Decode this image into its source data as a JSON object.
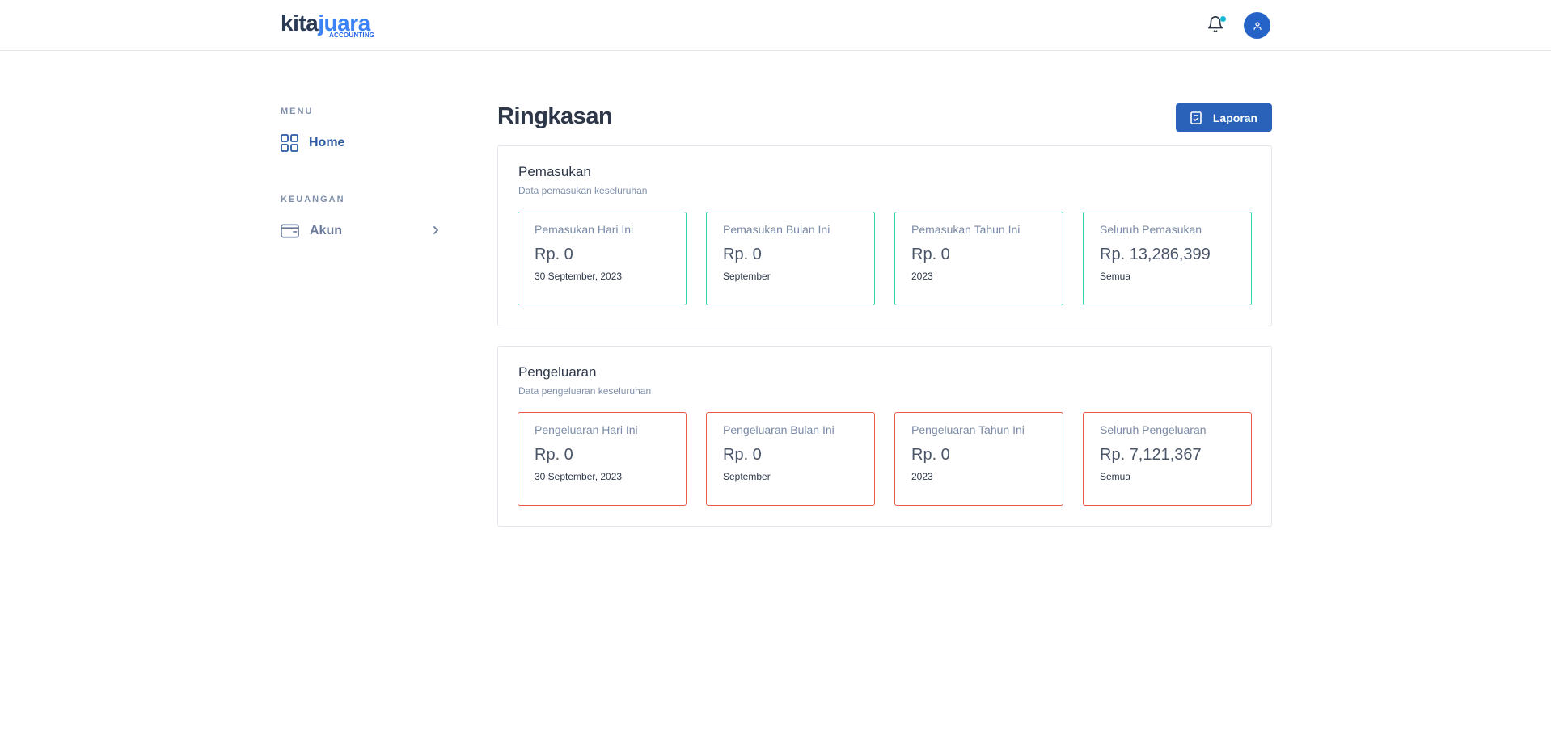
{
  "brand": {
    "part1": "kita",
    "part2": "juara",
    "sub": "ACCOUNTING"
  },
  "header": {
    "bell_icon": "bell-icon",
    "avatar_icon": "user-icon",
    "notification_color": "#14b8d4"
  },
  "sidebar": {
    "sections": [
      {
        "heading": "MENU",
        "items": [
          {
            "label": "Home",
            "icon": "grid-icon",
            "active": true
          }
        ]
      },
      {
        "heading": "KEUANGAN",
        "items": [
          {
            "label": "Akun",
            "icon": "wallet-icon",
            "active": false,
            "has_chevron": true
          }
        ]
      }
    ]
  },
  "main": {
    "title": "Ringkasan",
    "report_button": {
      "label": "Laporan",
      "icon": "report-icon"
    }
  },
  "panels": [
    {
      "title": "Pemasukan",
      "subtitle": "Data pemasukan keseluruhan",
      "accent": "#2fd6ad",
      "cards": [
        {
          "title": "Pemasukan Hari Ini",
          "amount": "Rp. 0",
          "note": "30 September, 2023"
        },
        {
          "title": "Pemasukan Bulan Ini",
          "amount": "Rp. 0",
          "note": "September"
        },
        {
          "title": "Pemasukan Tahun Ini",
          "amount": "Rp. 0",
          "note": "2023"
        },
        {
          "title": "Seluruh Pemasukan",
          "amount": "Rp. 13,286,399",
          "note": "Semua"
        }
      ]
    },
    {
      "title": "Pengeluaran",
      "subtitle": "Data pengeluaran keseluruhan",
      "accent": "#ea5a4b",
      "cards": [
        {
          "title": "Pengeluaran Hari Ini",
          "amount": "Rp. 0",
          "note": "30 September, 2023"
        },
        {
          "title": "Pengeluaran Bulan Ini",
          "amount": "Rp. 0",
          "note": "September"
        },
        {
          "title": "Pengeluaran Tahun Ini",
          "amount": "Rp. 0",
          "note": "2023"
        },
        {
          "title": "Seluruh Pengeluaran",
          "amount": "Rp. 7,121,367",
          "note": "Semua"
        }
      ]
    }
  ]
}
